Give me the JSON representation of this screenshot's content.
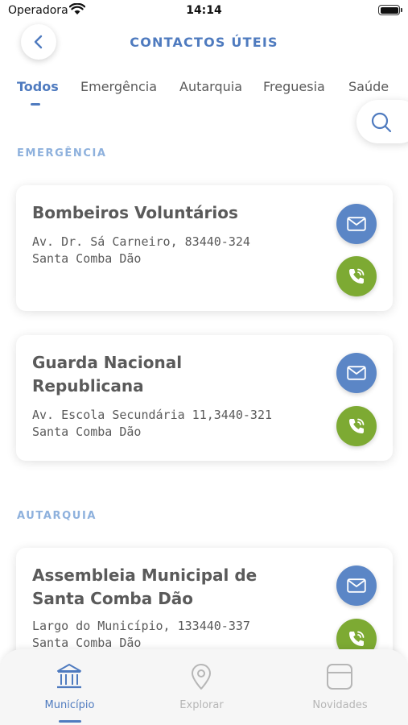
{
  "status_bar": {
    "carrier": "Operadora",
    "time": "14:14"
  },
  "header": {
    "title": "CONTACTOS ÚTEIS"
  },
  "tabs": [
    {
      "label": "Todos",
      "active": true
    },
    {
      "label": "Emergência",
      "active": false
    },
    {
      "label": "Autarquia",
      "active": false
    },
    {
      "label": "Freguesia",
      "active": false
    },
    {
      "label": "Saúde",
      "active": false
    }
  ],
  "sections": [
    {
      "title": "EMERGÊNCIA",
      "contacts": [
        {
          "name": "Bombeiros Voluntários",
          "address": "Av. Dr. Sá Carneiro, 83440-324 Santa Comba Dão"
        },
        {
          "name": "Guarda Nacional Republicana",
          "address": "Av. Escola Secundária 11,3440-321 Santa Comba Dão"
        }
      ]
    },
    {
      "title": "AUTARQUIA",
      "contacts": [
        {
          "name": "Assembleia Municipal de Santa Comba Dão",
          "address": "Largo do Município, 133440-337 Santa Comba Dão"
        }
      ]
    }
  ],
  "bottom_nav": [
    {
      "label": "Município",
      "icon": "town-hall-icon",
      "active": true
    },
    {
      "label": "Explorar",
      "icon": "map-pin-icon",
      "active": false
    },
    {
      "label": "Novidades",
      "icon": "news-icon",
      "active": false
    }
  ],
  "colors": {
    "accent": "#4f7bbf",
    "mail": "#5b86c6",
    "call": "#7daa33",
    "section": "#8eb1dd"
  }
}
